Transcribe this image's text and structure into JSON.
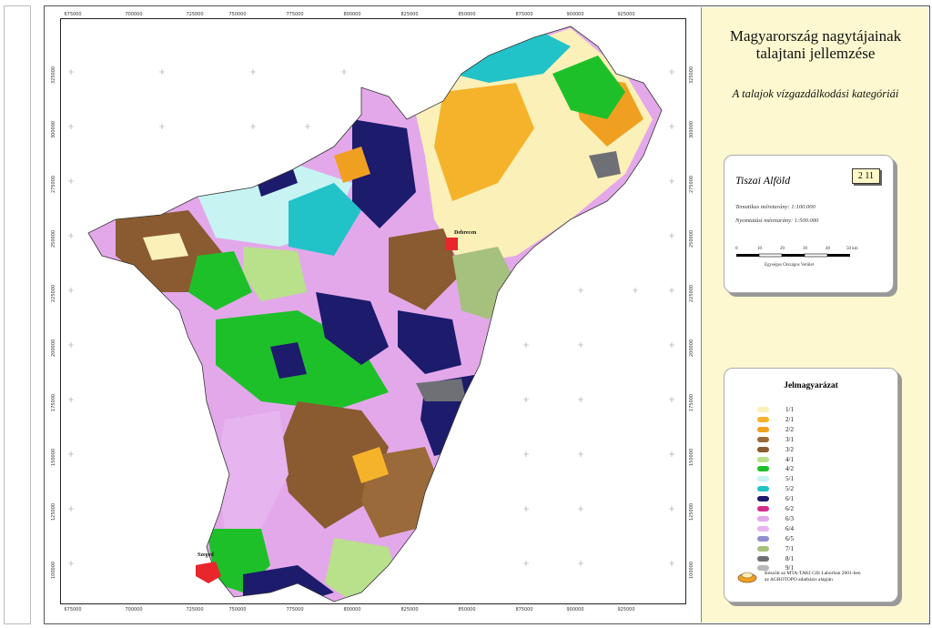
{
  "title_line1": "Magyarország nagytájainak",
  "title_line2": "talajtani jellemzése",
  "subtitle": "A talajok vízgazdálkodási kategóriái",
  "region": {
    "name": "Tiszai Alföld",
    "code": "2 11"
  },
  "scale": {
    "thematic": "Tematikus méretarány: 1:100.000",
    "print": "Nyomtatási méretarány: 1:500.000",
    "ticks": [
      "0",
      "10",
      "20",
      "30",
      "40",
      "50 km"
    ],
    "projection": "Egységes Országos Vetület"
  },
  "cities": [
    {
      "name": "Debrecen"
    },
    {
      "name": "Szeged"
    }
  ],
  "coord_top": [
    "675000",
    "700000",
    "725000",
    "750000",
    "775000",
    "800000",
    "825000",
    "850000",
    "875000",
    "900000",
    "925000"
  ],
  "coord_side": [
    "325000",
    "300000",
    "275000",
    "250000",
    "225000",
    "200000",
    "175000",
    "150000",
    "125000",
    "100000"
  ],
  "legend": {
    "title": "Jelmagyarázat",
    "items": [
      {
        "label": "1/1",
        "color": "#fbf0b8"
      },
      {
        "label": "2/1",
        "color": "#f5b32b"
      },
      {
        "label": "2/2",
        "color": "#f0a020"
      },
      {
        "label": "3/1",
        "color": "#9a6a3a"
      },
      {
        "label": "3/2",
        "color": "#8a5a30"
      },
      {
        "label": "4/1",
        "color": "#b9e08a"
      },
      {
        "label": "4/2",
        "color": "#1ec02a"
      },
      {
        "label": "5/1",
        "color": "#c7f3f3"
      },
      {
        "label": "5/2",
        "color": "#22c3c8"
      },
      {
        "label": "6/1",
        "color": "#1c1b6c"
      },
      {
        "label": "6/2",
        "color": "#d42e8a"
      },
      {
        "label": "6/3",
        "color": "#e3a8ea"
      },
      {
        "label": "6/4",
        "color": "#e6b4ee"
      },
      {
        "label": "6/5",
        "color": "#8f8fcf"
      },
      {
        "label": "7/1",
        "color": "#a6c07e"
      },
      {
        "label": "8/1",
        "color": "#6f7076"
      },
      {
        "label": "9/1",
        "color": "#b8b8b8"
      }
    ]
  },
  "credit_line1": "Készült az MTA-TAKI GIS Laborban 2001-ben",
  "credit_line2": "az AGROTOPO adatbázis alapján",
  "colors": {
    "panel_bg": "#fdf8cf",
    "city_red": "#e8262c"
  }
}
